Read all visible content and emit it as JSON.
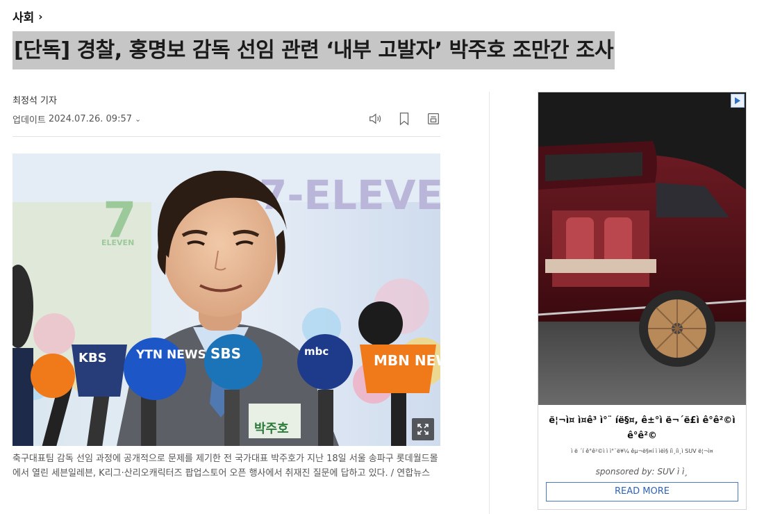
{
  "section": {
    "label": "사회",
    "chevron": "›"
  },
  "article": {
    "headline": "[단독] 경찰, 홍명보 감독 선임 관련 ‘내부 고발자’ 박주호 조만간 조사",
    "byline": "최정석 기자",
    "update_label": "업데이트",
    "update_time": "2024.07.26. 09:57",
    "toolbar": {
      "icons": [
        "speaker-icon",
        "bookmark-icon",
        "print-icon"
      ]
    },
    "photo": {
      "broadcaster_logos": [
        "KBS",
        "YTN NEWS",
        "SBS",
        "mbc",
        "MBN NEWS",
        "KBS"
      ],
      "backdrop_text": "7-ELEVE",
      "store_logo": "7",
      "store_logo_sub": "ELEVEN",
      "name_tag": "박주호",
      "expand_icon": "expand-icon"
    },
    "caption": "축구대표팀 감독 선임 과정에 공개적으로 문제를 제기한 전 국가대표 박주호가 지난 18일 서울 송파구 롯데월드몰에서 열린 세븐일레븐, K리그·산리오캐릭터즈 팝업스토어 오픈 행사에서 취재진 질문에 답하고 있다. / 연합뉴스"
  },
  "ad": {
    "headline": "ë¦¬ì¤ ì¤ê³ ì°¨ íë§¤, ê±°ì ë¬´ë£ì ê°ê²©ì ê°ê²©",
    "description": "ì ë ´í ê°ê²©ì ì ì°¨ë¥¼ êµ¬ë§¤í  ì ìëì§ íì¸íì¸ì SUV ë¦¬ì¤",
    "sponsor": "sponsored by: SUV ì ì¸",
    "cta": "READ MORE",
    "choice_icon": "adchoices-icon"
  },
  "colors": {
    "headline_highlight": "#c6c6c6",
    "ad_button": "#2f62b6",
    "mbn_orange": "#f07a1a"
  }
}
